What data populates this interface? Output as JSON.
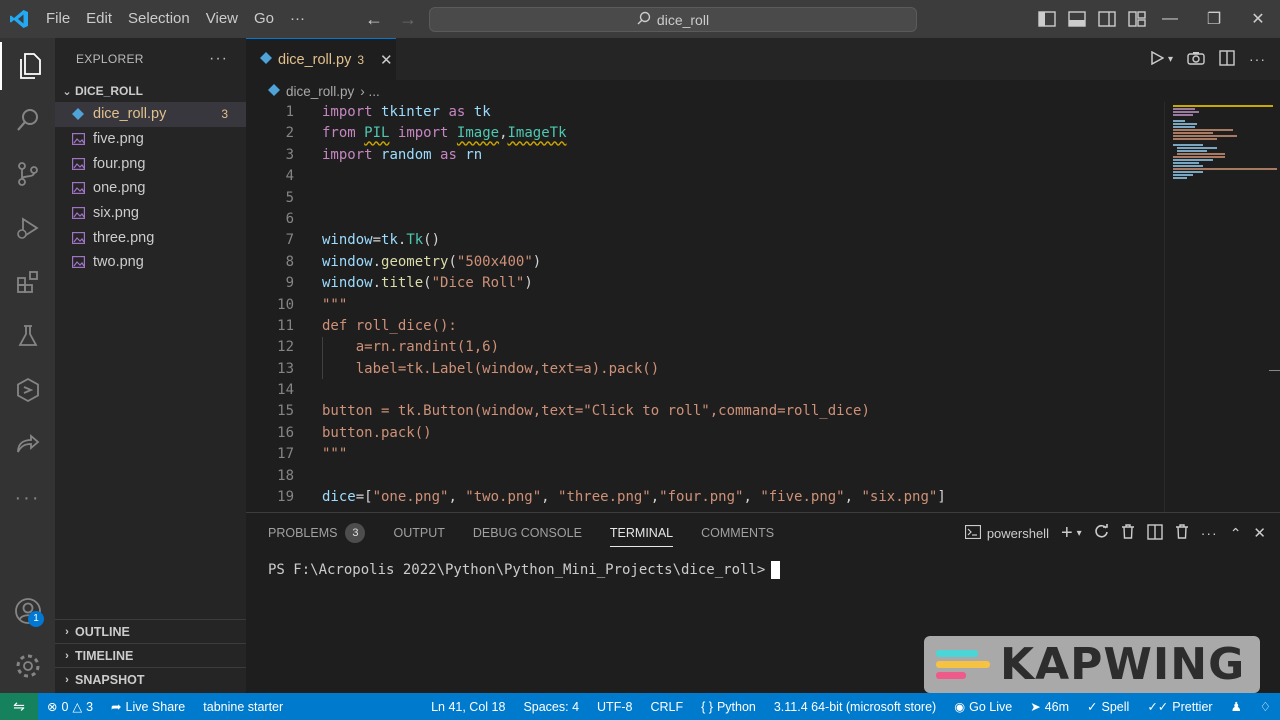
{
  "titlebar": {
    "menu": [
      "File",
      "Edit",
      "Selection",
      "View",
      "Go",
      "···"
    ],
    "search_text": "dice_roll",
    "back_icon": "arrow-left-icon",
    "forward_icon": "arrow-right-icon"
  },
  "activity": {
    "accounts_badge": "1"
  },
  "sidebar": {
    "header": "EXPLORER",
    "more": "···",
    "folder": "DICE_ROLL",
    "files": [
      {
        "name": "dice_roll.py",
        "badge": "3"
      },
      {
        "name": "five.png"
      },
      {
        "name": "four.png"
      },
      {
        "name": "one.png"
      },
      {
        "name": "six.png"
      },
      {
        "name": "three.png"
      },
      {
        "name": "two.png"
      }
    ],
    "sections": [
      "OUTLINE",
      "TIMELINE",
      "SNAPSHOT"
    ]
  },
  "editor": {
    "tab": {
      "name": "dice_roll.py",
      "count": "3"
    },
    "breadcrumb": {
      "file": "dice_roll.py",
      "rest": "› ..."
    },
    "line_numbers": [
      "1",
      "2",
      "3",
      "4",
      "5",
      "6",
      "7",
      "8",
      "9",
      "10",
      "11",
      "12",
      "13",
      "14",
      "15",
      "16",
      "17",
      "18",
      "19"
    ]
  },
  "panel": {
    "tabs": {
      "problems": "PROBLEMS",
      "problems_count": "3",
      "output": "OUTPUT",
      "debug": "DEBUG CONSOLE",
      "terminal": "TERMINAL",
      "comments": "COMMENTS"
    },
    "shell": "powershell",
    "prompt": "PS F:\\Acropolis 2022\\Python\\Python_Mini_Projects\\dice_roll>"
  },
  "status": {
    "errors": "0",
    "warnings": "3",
    "live_share": "Live Share",
    "tabnine": "tabnine starter",
    "position": "Ln 41, Col 18",
    "spaces": "Spaces: 4",
    "encoding": "UTF-8",
    "eol": "CRLF",
    "language": "Python",
    "interpreter": "3.11.4 64-bit (microsoft store)",
    "go_live": "Go Live",
    "time": "46m",
    "spell": "Spell",
    "prettier": "Prettier"
  },
  "watermark": {
    "text": "KAPWING"
  },
  "colors": {
    "accent": "#007acc",
    "titlebar": "#3c3c3c",
    "sidebar": "#252526",
    "editor": "#1e1e1e",
    "modified": "#e2c08d"
  }
}
